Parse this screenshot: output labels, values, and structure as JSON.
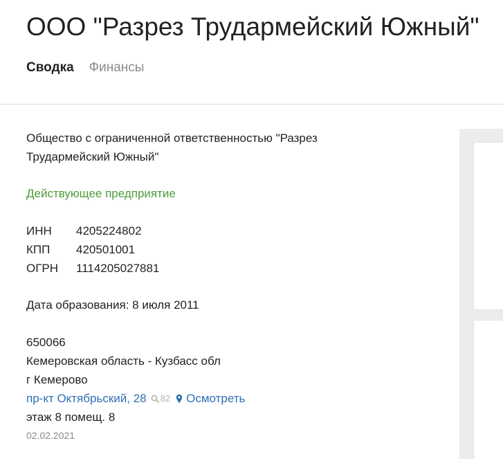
{
  "header": {
    "title": "ООО \"Разрез Трудармейский Южный\""
  },
  "tabs": [
    {
      "label": "Сводка",
      "active": true
    },
    {
      "label": "Финансы",
      "active": false
    }
  ],
  "summary": {
    "full_name": "Общество с ограниченной ответственностью \"Разрез Трудармейский Южный\"",
    "status": "Действующее предприятие",
    "status_color": "#4d9a3a",
    "codes": [
      {
        "label": "ИНН",
        "value": "4205224802"
      },
      {
        "label": "КПП",
        "value": "420501001"
      },
      {
        "label": "ОГРН",
        "value": "1114205027881"
      }
    ],
    "registration": "Дата образования: 8 июля 2011",
    "address": {
      "postal_code": "650066",
      "region": "Кемеровская область - Кузбасс обл",
      "city": "г Кемерово",
      "street": "пр-кт Октябрьский, 28",
      "search_count": "82",
      "view_label": "Осмотреть",
      "premises": "этаж 8 помещ. 8",
      "updated": "02.02.2021"
    }
  },
  "colors": {
    "link": "#2f6fb5",
    "muted": "#8a8a8a"
  },
  "icons": {
    "search": "search-icon",
    "map_pin": "map-pin-icon"
  }
}
